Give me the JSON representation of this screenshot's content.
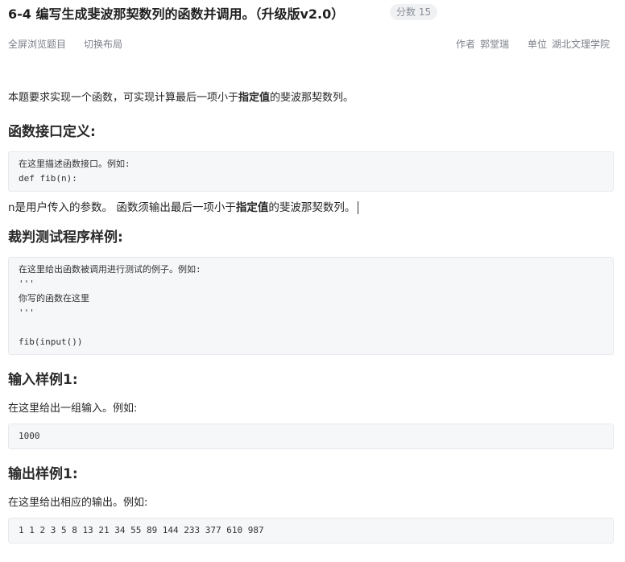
{
  "header": {
    "title": "6-4 编写生成斐波那契数列的函数并调用。（升级版v2.0）",
    "score": "分数 15"
  },
  "toolbar": {
    "fullscreen": "全屏浏览题目",
    "switch_layout": "切换布局",
    "author_label": "作者",
    "author": "郭堂瑞",
    "unit_label": "单位",
    "unit": "湖北文理学院"
  },
  "problem": {
    "intro_pre": "本题要求实现一个函数，可实现计算最后一项小于",
    "intro_bold": "指定值",
    "intro_post": "的斐波那契数列。",
    "interface_heading": "函数接口定义:",
    "interface_code": [
      "在这里描述函数接口。例如:",
      "def fib(n):"
    ],
    "param_pre": "n是用户传入的参数。 函数须输出最后一项小于",
    "param_bold": "指定值",
    "param_post": "的斐波那契数列。",
    "test_heading": "裁判测试程序样例:",
    "test_code": [
      "在这里给出函数被调用进行测试的例子。例如:",
      "'''",
      "你写的函数在这里",
      "'''",
      "",
      "fib(input())"
    ],
    "input_heading": "输入样例1:",
    "input_desc": "在这里给出一组输入。例如:",
    "input_code": [
      "1000"
    ],
    "output_heading": "输出样例1:",
    "output_desc": "在这里给出相应的输出。例如:",
    "output_code": [
      "1 1 2 3 5 8 13 21 34 55 89 144 233 377 610 987"
    ]
  }
}
